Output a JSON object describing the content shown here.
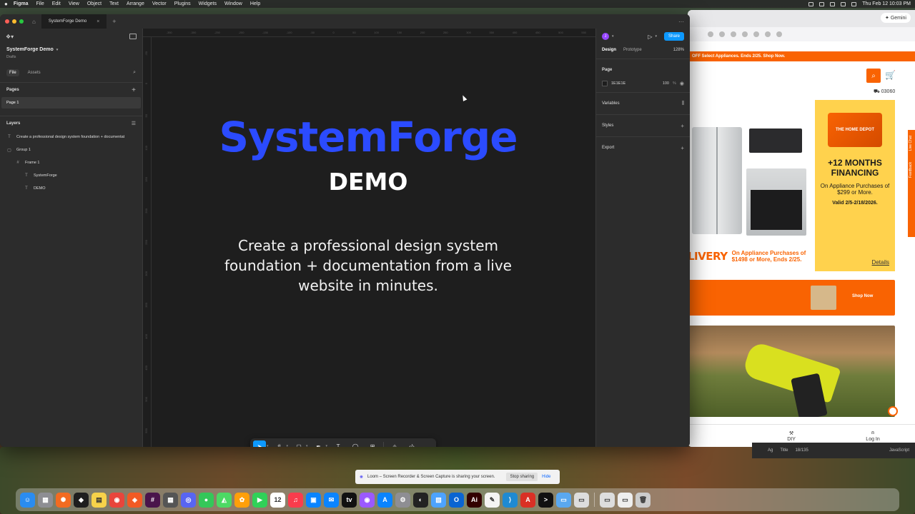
{
  "menubar": {
    "apple": "",
    "items": [
      "Figma",
      "File",
      "Edit",
      "View",
      "Object",
      "Text",
      "Arrange",
      "Vector",
      "Plugins",
      "Widgets",
      "Window",
      "Help"
    ],
    "datetime": "Thu Feb 12  10:03 PM"
  },
  "figma": {
    "tab_title": "SystemForge Demo",
    "file_title": "SystemForge Demo",
    "file_subtitle": "Drafts",
    "left_tabs": {
      "file": "File",
      "assets": "Assets"
    },
    "pages_heading": "Pages",
    "pages": [
      "Page 1"
    ],
    "layers_heading": "Layers",
    "layers": [
      {
        "icon": "text-icon",
        "label": "Create a professional design system foundation + documentat",
        "depth": 0
      },
      {
        "icon": "group-icon",
        "label": "Group 1",
        "depth": 0
      },
      {
        "icon": "frame-icon",
        "label": "Frame 1",
        "depth": 1
      },
      {
        "icon": "text-icon",
        "label": "SystemForge",
        "depth": 2
      },
      {
        "icon": "text-icon",
        "label": "DEMO",
        "depth": 2
      }
    ],
    "canvas": {
      "title": "SystemForge",
      "subtitle": "DEMO",
      "body": "Create a professional design system foundation + documentation from a live website in minutes.",
      "title_color": "#2b4bff",
      "ruler_top": [
        "-350",
        "-300",
        "-250",
        "-200",
        "-150",
        "-100",
        "-50",
        "0",
        "50",
        "100",
        "150",
        "200",
        "250",
        "300",
        "350",
        "400",
        "450",
        "500",
        "550"
      ],
      "ruler_left": [
        "-50",
        "0",
        "50",
        "100",
        "150",
        "200",
        "250",
        "300",
        "350",
        "400",
        "450",
        "500",
        "550"
      ]
    },
    "right": {
      "avatar_initial": "J",
      "share_label": "Share",
      "tab_design": "Design",
      "tab_prototype": "Prototype",
      "zoom": "128%",
      "page_heading": "Page",
      "page_color": "1E1E1E",
      "page_opacity": "100",
      "page_opacity_unit": "%",
      "variables_label": "Variables",
      "styles_label": "Styles",
      "export_label": "Export"
    },
    "help_label": "?"
  },
  "browser": {
    "gemini_label": "Gemini",
    "promo_text": "OFF Select Appliances. Ends 2/25. Shop Now.",
    "zip": "03060",
    "delivery_big": "LIVERY",
    "delivery_small": "On Appliance Purchases of $1498 or More, Ends 2/25.",
    "financing_title": "+12 MONTHS FINANCING",
    "financing_sub": "On Appliance Purchases of $299 or More.",
    "financing_valid": "Valid 2/5-2/18/2026.",
    "financing_details": "Details",
    "shop_now": "Shop Now",
    "side_tabs": [
      "Live Chat",
      "Feedback"
    ],
    "nav": [
      {
        "icon": "hammer-icon",
        "label": "DIY"
      },
      {
        "icon": "user-icon",
        "label": "Log In"
      }
    ],
    "card_label": "THE HOME DEPOT"
  },
  "under_bar": {
    "font_label": "Ag",
    "title_label": "Title",
    "count": "18/135",
    "js_label": "JavaScript"
  },
  "loom": {
    "message": "Loom – Screen Recorder & Screen Capture is sharing your screen.",
    "stop_label": "Stop sharing",
    "hide_label": "Hide"
  },
  "dock": {
    "apps": [
      {
        "name": "finder-icon",
        "color": "#2a8cf0",
        "glyph": "☺"
      },
      {
        "name": "launchpad-icon",
        "color": "#8e8e93",
        "glyph": "▦"
      },
      {
        "name": "app-icon-1",
        "color": "#f36b21",
        "glyph": "✺"
      },
      {
        "name": "figma-icon",
        "color": "#1e1e1e",
        "glyph": "◆"
      },
      {
        "name": "notes-icon",
        "color": "#f7d24a",
        "glyph": "▤"
      },
      {
        "name": "chrome-icon",
        "color": "#e8453c",
        "glyph": "◉"
      },
      {
        "name": "brave-icon",
        "color": "#f15a24",
        "glyph": "◈"
      },
      {
        "name": "slack-icon",
        "color": "#4a154b",
        "glyph": "#"
      },
      {
        "name": "calculator-icon",
        "color": "#555555",
        "glyph": "▦"
      },
      {
        "name": "discord-icon",
        "color": "#5865f2",
        "glyph": "◎"
      },
      {
        "name": "messages-icon",
        "color": "#34c759",
        "glyph": "●"
      },
      {
        "name": "maps-icon",
        "color": "#4cd964",
        "glyph": "◭"
      },
      {
        "name": "photos-icon",
        "color": "#ff9f0a",
        "glyph": "✿"
      },
      {
        "name": "facetime-icon",
        "color": "#30d158",
        "glyph": "▶"
      },
      {
        "name": "calendar-icon",
        "color": "#ffffff",
        "glyph": "12"
      },
      {
        "name": "music-icon",
        "color": "#fa3c4c",
        "glyph": "♫"
      },
      {
        "name": "app-icon-2",
        "color": "#0a84ff",
        "glyph": "▣"
      },
      {
        "name": "app-icon-3",
        "color": "#0a84ff",
        "glyph": "✉"
      },
      {
        "name": "tv-icon",
        "color": "#111111",
        "glyph": "tv"
      },
      {
        "name": "podcasts-icon",
        "color": "#9b59ff",
        "glyph": "◉"
      },
      {
        "name": "app-store-icon",
        "color": "#0a84ff",
        "glyph": "A"
      },
      {
        "name": "settings-icon",
        "color": "#8e8e93",
        "glyph": "⚙"
      },
      {
        "name": "activity-monitor-icon",
        "color": "#222222",
        "glyph": "◐"
      },
      {
        "name": "preview-icon",
        "color": "#4da3ff",
        "glyph": "▧"
      },
      {
        "name": "outlook-icon",
        "color": "#0a64d2",
        "glyph": "O"
      },
      {
        "name": "illustrator-icon",
        "color": "#330000",
        "glyph": "Ai"
      },
      {
        "name": "textedit-icon",
        "color": "#f4f4f4",
        "glyph": "✎"
      },
      {
        "name": "vscode-icon",
        "color": "#1f8ad2",
        "glyph": "⟩"
      },
      {
        "name": "acrobat-icon",
        "color": "#d93025",
        "glyph": "A"
      },
      {
        "name": "terminal-icon",
        "color": "#111111",
        "glyph": ">"
      },
      {
        "name": "folder-icon-1",
        "color": "#5aa8f0",
        "glyph": "▭"
      },
      {
        "name": "folder-icon-2",
        "color": "#dddddd",
        "glyph": "▭"
      },
      {
        "name": "folder-icon-3",
        "color": "#dddddd",
        "glyph": "▭"
      },
      {
        "name": "folder-icon-4",
        "color": "#eeeeee",
        "glyph": "▭"
      },
      {
        "name": "trash-icon",
        "color": "#cccccc",
        "glyph": "🗑"
      }
    ]
  }
}
